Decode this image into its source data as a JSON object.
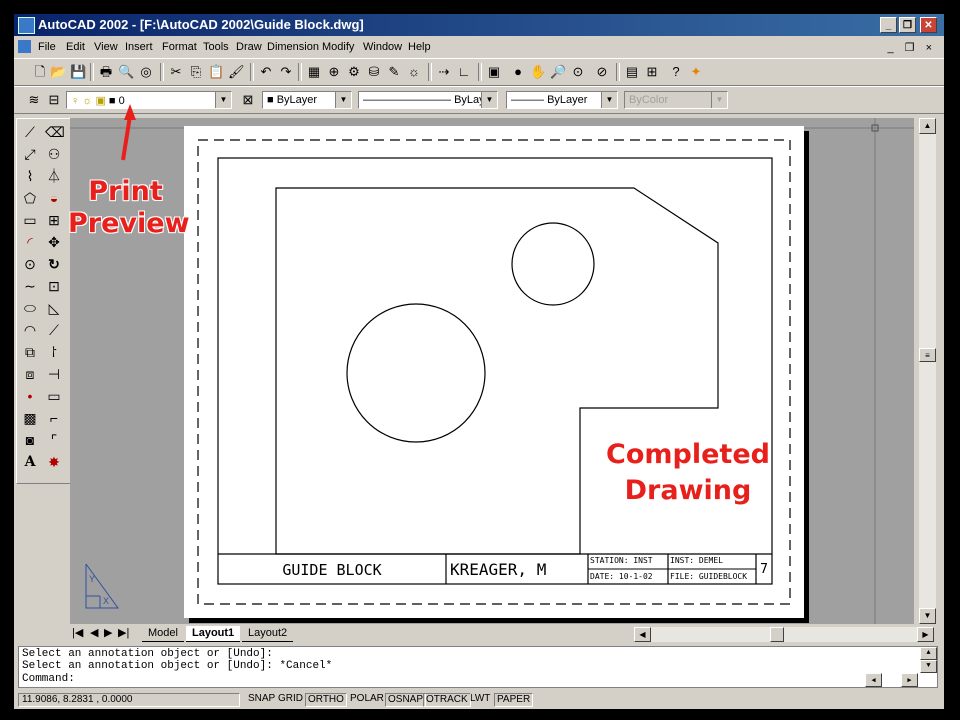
{
  "window": {
    "title": "AutoCAD 2002 - [F:\\AutoCAD 2002\\Guide Block.dwg]",
    "controls": {
      "minimize": "_",
      "restore": "❐",
      "close": "✕"
    }
  },
  "menu": {
    "items": [
      "File",
      "Edit",
      "View",
      "Insert",
      "Format",
      "Tools",
      "Draw",
      "Dimension",
      "Modify",
      "Window",
      "Help"
    ],
    "mdi_controls": "_ ❐ ×"
  },
  "layers_toolbar": {
    "layer_value": "0",
    "color_value": "ByLayer",
    "linetype_value": "ByLayer",
    "lineweight_value": "ByLayer",
    "plotstyle_value": "ByColor"
  },
  "drawing": {
    "title_block": {
      "name": "GUIDE BLOCK",
      "author": "KREAGER, M",
      "station": "STATION: INST",
      "instructor": "INST: DEMEL",
      "date": "DATE: 10-1-02",
      "file": "FILE: GUIDEBLOCK",
      "sheet": "7"
    }
  },
  "ucs": {
    "y": "Y",
    "x": "X"
  },
  "layout_tabs": {
    "nav": [
      "|◀",
      "◀",
      "▶",
      "▶|"
    ],
    "tabs": [
      "Model",
      "Layout1",
      "Layout2"
    ],
    "active": "Layout1"
  },
  "command": {
    "lines": [
      "Select an annotation object or [Undo]:",
      "Select an annotation object or [Undo]: *Cancel*",
      "Command:"
    ]
  },
  "status": {
    "coords": "11.9086, 8.2831 , 0.0000",
    "buttons": [
      {
        "label": "SNAP",
        "on": false
      },
      {
        "label": "GRID",
        "on": false
      },
      {
        "label": "ORTHO",
        "on": true
      },
      {
        "label": "POLAR",
        "on": false
      },
      {
        "label": "OSNAP",
        "on": true
      },
      {
        "label": "OTRACK",
        "on": true
      },
      {
        "label": "LWT",
        "on": false
      },
      {
        "label": "PAPER",
        "on": true
      }
    ]
  },
  "annotations": {
    "print_preview": [
      "Print",
      "Preview"
    ],
    "completed": [
      "Completed",
      "Drawing"
    ]
  },
  "colors": {
    "annotation": "#e8201c",
    "titlebar": "#0a246a",
    "canvas": "#a0a0a0"
  }
}
